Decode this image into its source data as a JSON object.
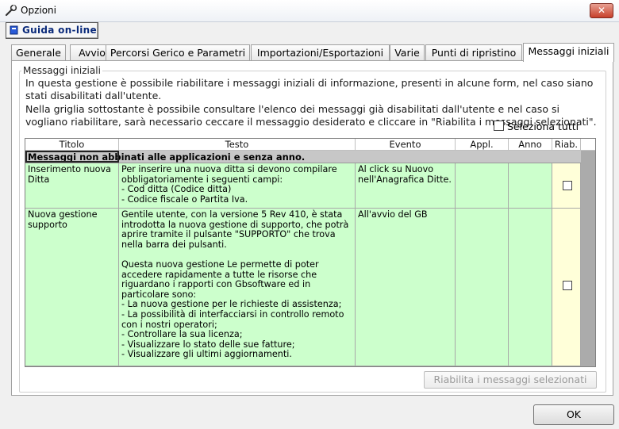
{
  "window": {
    "title": "Opzioni",
    "icon": "wrench-icon",
    "close_label": "✕"
  },
  "guide_button": {
    "label": "Guida on-line",
    "icon": "book-icon"
  },
  "tabs": [
    {
      "label": "Generale",
      "active": false
    },
    {
      "label": "Avvio",
      "active": false
    },
    {
      "label": "Percorsi Gerico e Parametri",
      "active": false
    },
    {
      "label": "Importazioni/Esportazioni",
      "active": false
    },
    {
      "label": "Varie",
      "active": false
    },
    {
      "label": "Punti di ripristino",
      "active": false
    },
    {
      "label": "Messaggi iniziali",
      "active": true
    }
  ],
  "group": {
    "title": "Messaggi iniziali",
    "intro_1": "In questa gestione è possibile riabilitare i messaggi iniziali di informazione, presenti in alcune form, nel caso siano stati disabilitati dall'utente.",
    "intro_2": "Nella griglia sottostante è possibile consultare l'elenco dei messaggi già disabilitati dall'utente e nel caso si vogliano riabilitare, sarà necessario ceccare il messaggio desiderato e cliccare in \"Riabilita i messaggi selezionati\".",
    "select_all_label": "Seleziona tutti"
  },
  "grid": {
    "columns": [
      "Titolo",
      "Testo",
      "Evento",
      "Appl.",
      "Anno",
      "Riab."
    ],
    "group_label": "Messaggi non abbinati alle applicazioni e senza anno.",
    "rows": [
      {
        "titolo": "Inserimento nuova Ditta",
        "testo": "Per inserire una nuova ditta si devono compilare obbligatoriamente i seguenti campi:\n- Cod ditta (Codice ditta)\n- Codice fiscale o Partita Iva.",
        "evento": "Al click  su Nuovo nell'Anagrafica Ditte.",
        "appl": "",
        "anno": "",
        "riab": false
      },
      {
        "titolo": "Nuova gestione supporto",
        "testo": "Gentile utente, con la versione 5 Rev 410, è stata introdotta la nuova gestione di supporto, che potrà aprire tramite il pulsante \"SUPPORTO\" che trova nella barra dei pulsanti.\n\nQuesta nuova gestione Le permette di poter accedere rapidamente a tutte le risorse che riguardano i rapporti con Gbsoftware ed in particolare sono:\n- La nuova gestione per le richieste di assistenza;\n- La possibilità di interfacciarsi in controllo remoto con i nostri operatori;\n- Controllare la sua licenza;\n- Visualizzare lo stato delle sue fatture;\n- Visualizzare gli ultimi aggiornamenti.",
        "evento": "All'avvio del GB",
        "appl": "",
        "anno": "",
        "riab": false
      }
    ]
  },
  "apply_button": {
    "label": "Riabilita i messaggi selezionati",
    "enabled": false
  },
  "ok_button": {
    "label": "OK"
  },
  "colors": {
    "row_green": "#ccffcc",
    "riab_yellow": "#ffffd9",
    "close_red": "#c7402b"
  }
}
